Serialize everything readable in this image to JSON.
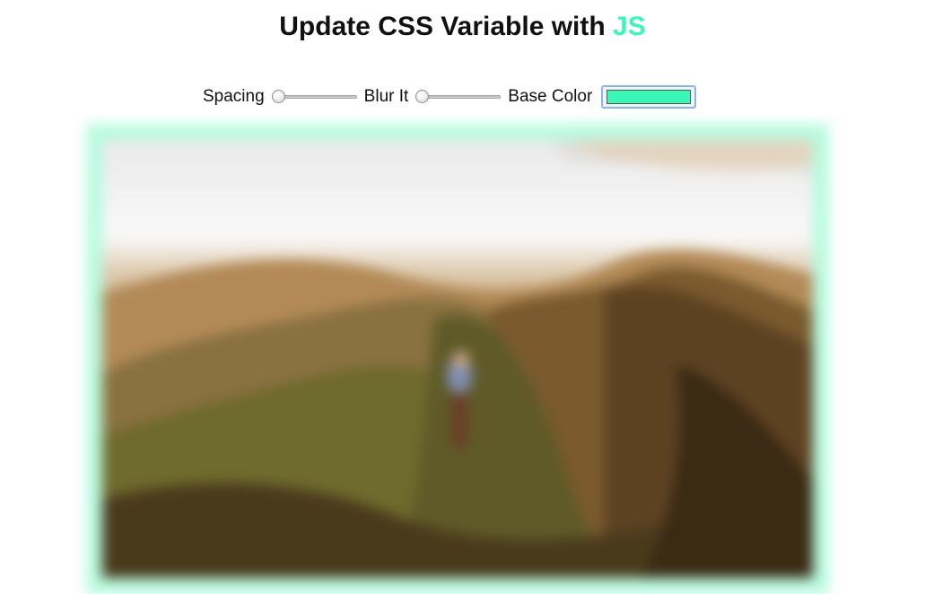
{
  "heading": {
    "prefix": "Update CSS Variable with ",
    "accent": "JS"
  },
  "controls": {
    "spacing_label": "Spacing",
    "blur_label": "Blur It",
    "base_color_label": "Base Color",
    "spacing_value": 0,
    "blur_value": 0,
    "base_color_value": "#39f7b4"
  },
  "colors": {
    "accent": "#39f7b4",
    "frame_glow": "#b7fbe0",
    "text": "#111111"
  },
  "image": {
    "subject": "blurred mountain ridge with hiker"
  }
}
